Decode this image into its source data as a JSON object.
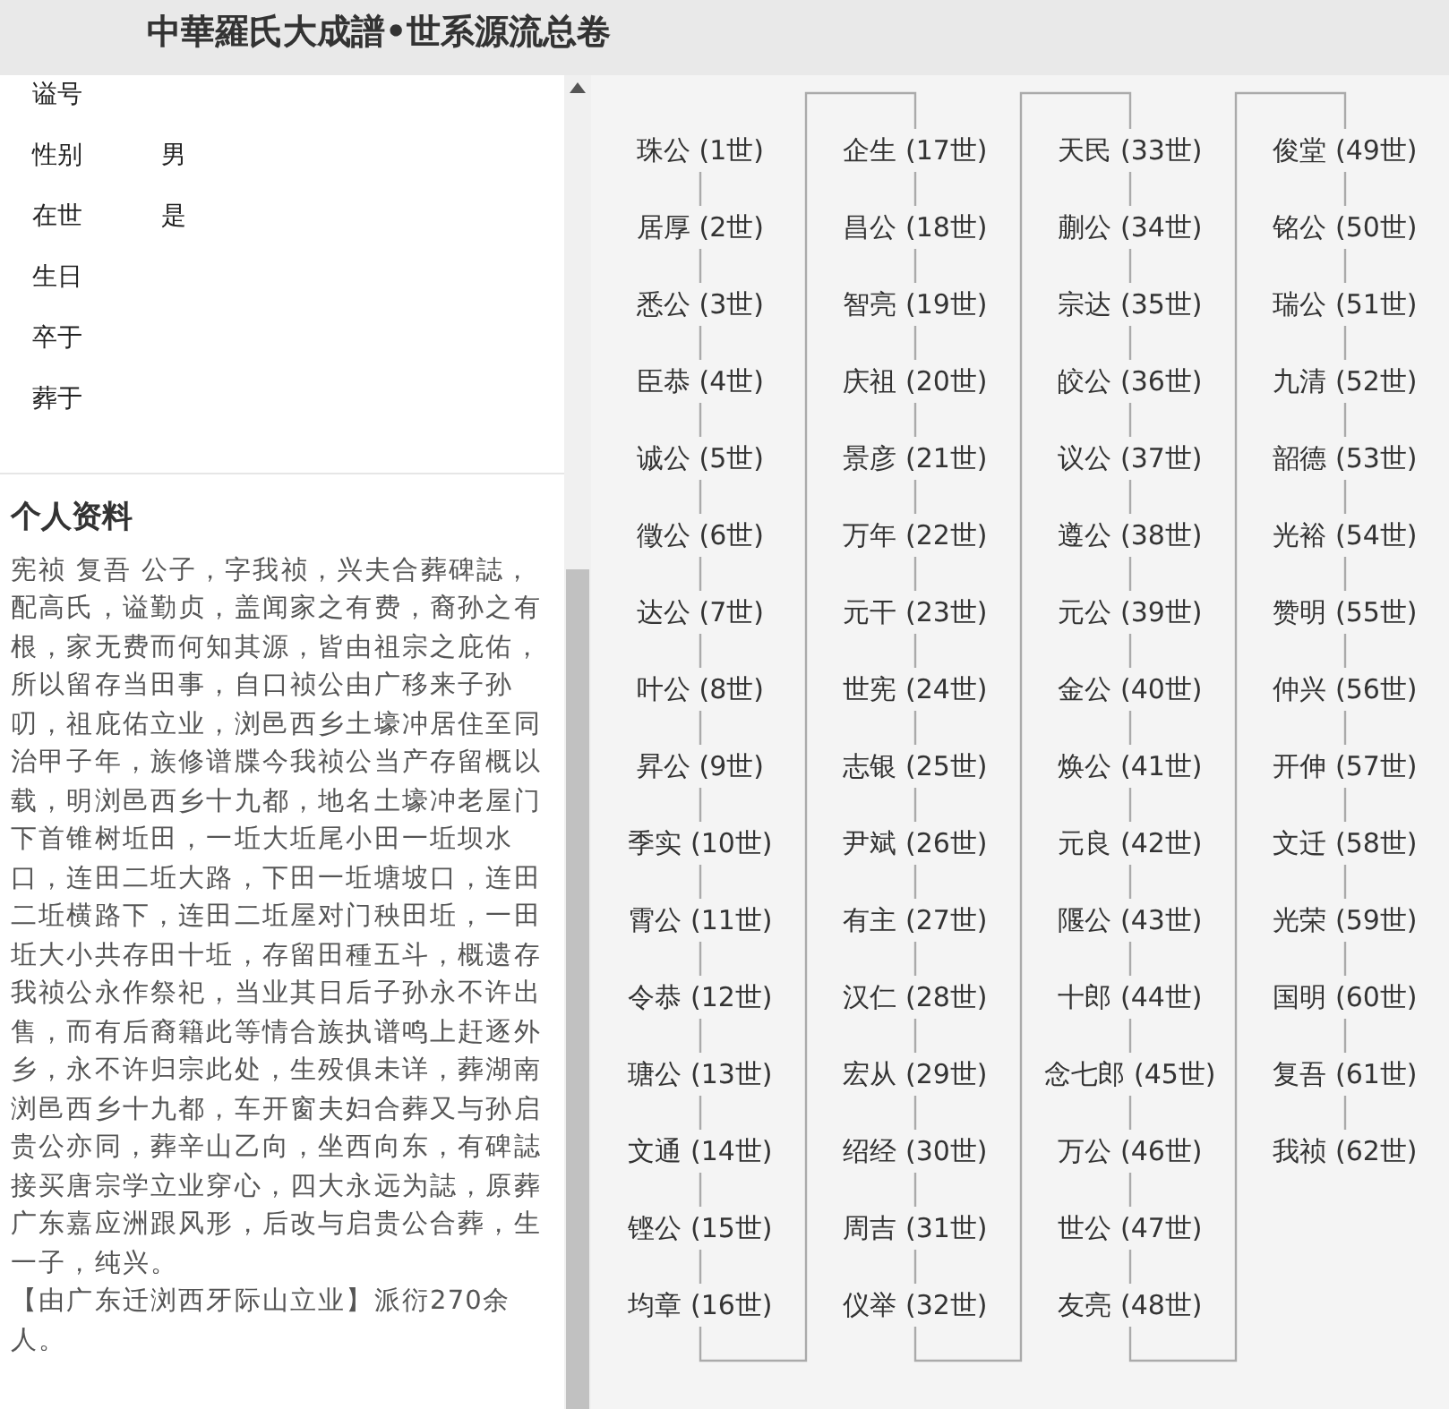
{
  "title": "中華羅氏大成譜•世系源流总卷",
  "fields": [
    {
      "label": "谥号"
    },
    {
      "label": "性别",
      "value": "男"
    },
    {
      "label": "在世",
      "value": "是"
    },
    {
      "label": "生日"
    },
    {
      "label": "卒于"
    },
    {
      "label": "葬于"
    }
  ],
  "profile": {
    "heading": "个人资料",
    "paragraphs": [
      "宪祯 复吾 公子，字我祯，兴夫合葬碑誌，配高氏，谥勤贞，盖闻家之有费，裔孙之有根，家无费而何知其源，皆由祖宗之庇佑，所以留存当田事，自口祯公由广移来子孙叨，祖庇佑立业，浏邑西乡土壕冲居住至同治甲子年，族修谱牒今我祯公当产存留概以载，明浏邑西乡十九都，地名土壕冲老屋门下首锥树坵田，一坵大坵尾小田一坵坝水口，连田二坵大路，下田一坵塘坡口，连田二坵横路下，连田二坵屋对门秧田坵，一田坵大小共存田十坵，存留田種五斗，概遗存我祯公永作祭祀，当业其日后子孙永不许出售，而有后裔籍此等情合族执谱鸣上赶逐外乡，永不许归宗此处，生殁俱未详，葬湖南浏邑西乡十九都，车开窗夫妇合葬又与孙启贵公亦同，葬辛山乙向，坐西向东，有碑誌接买唐宗学立业穿心，四大永远为誌，原葬广东嘉应洲跟风形，后改与启贵公合葬，生一子，纯兴。",
      "【由广东迁浏西牙际山立业】派衍270余人。"
    ]
  },
  "lineage": [
    [
      "珠公 (1世)",
      "居厚 (2世)",
      "悉公 (3世)",
      "臣恭 (4世)",
      "诚公 (5世)",
      "徵公 (6世)",
      "达公 (7世)",
      "叶公 (8世)",
      "昇公 (9世)",
      "季实 (10世)",
      "霄公 (11世)",
      "令恭 (12世)",
      "瑭公 (13世)",
      "文通 (14世)",
      "铿公 (15世)",
      "均章 (16世)"
    ],
    [
      "企生 (17世)",
      "昌公 (18世)",
      "智亮 (19世)",
      "庆祖 (20世)",
      "景彦 (21世)",
      "万年 (22世)",
      "元干 (23世)",
      "世宪 (24世)",
      "志银 (25世)",
      "尹斌 (26世)",
      "有主 (27世)",
      "汉仁 (28世)",
      "宏从 (29世)",
      "绍经 (30世)",
      "周吉 (31世)",
      "仪举 (32世)"
    ],
    [
      "天民 (33世)",
      "蒯公 (34世)",
      "宗达 (35世)",
      "皎公 (36世)",
      "议公 (37世)",
      "遵公 (38世)",
      "元公 (39世)",
      "金公 (40世)",
      "焕公 (41世)",
      "元良 (42世)",
      "隁公 (43世)",
      "十郎 (44世)",
      "念七郎 (45世)",
      "万公 (46世)",
      "世公 (47世)",
      "友亮 (48世)"
    ],
    [
      "俊堂 (49世)",
      "铭公 (50世)",
      "瑞公 (51世)",
      "九清 (52世)",
      "韶德 (53世)",
      "光裕 (54世)",
      "赞明 (55世)",
      "仲兴 (56世)",
      "开伸 (57世)",
      "文迁 (58世)",
      "光荣 (59世)",
      "国明 (60世)",
      "复吾 (61世)",
      "我祯 (62世)"
    ]
  ]
}
